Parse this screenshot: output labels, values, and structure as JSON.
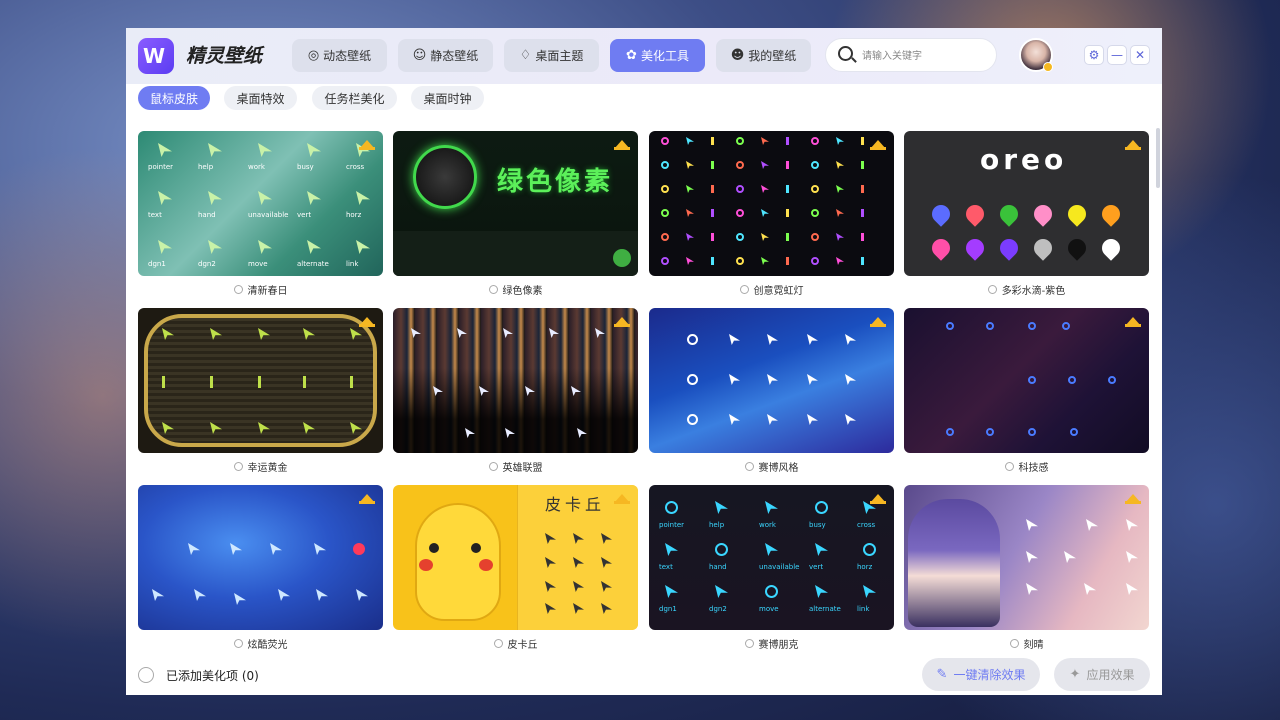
{
  "app": {
    "title": "精灵壁纸",
    "logo_letter": "W"
  },
  "nav": {
    "tabs": [
      {
        "label": "动态壁纸",
        "icon": "◎",
        "active": false
      },
      {
        "label": "静态壁纸",
        "icon": "☺",
        "active": false
      },
      {
        "label": "桌面主题",
        "icon": "♢",
        "active": false
      },
      {
        "label": "美化工具",
        "icon": "✿",
        "active": true
      },
      {
        "label": "我的壁纸",
        "icon": "☻",
        "active": false
      }
    ]
  },
  "search": {
    "placeholder": "请输入关键字",
    "value": ""
  },
  "window_controls": {
    "settings": "⚙",
    "minimize": "—",
    "close": "✕"
  },
  "subtabs": [
    {
      "label": "鼠标皮肤",
      "active": true
    },
    {
      "label": "桌面特效",
      "active": false
    },
    {
      "label": "任务栏美化",
      "active": false
    },
    {
      "label": "桌面时钟",
      "active": false
    }
  ],
  "items": [
    {
      "name": "清新春日",
      "premium": true
    },
    {
      "name": "绿色像素",
      "premium": true
    },
    {
      "name": "创意霓虹灯",
      "premium": true
    },
    {
      "name": "多彩水滴-紫色",
      "premium": true
    },
    {
      "name": "幸运黄金",
      "premium": true
    },
    {
      "name": "英雄联盟",
      "premium": true
    },
    {
      "name": "赛博风格",
      "premium": true
    },
    {
      "name": "科技感",
      "premium": true
    },
    {
      "name": "炫酷荧光",
      "premium": true
    },
    {
      "name": "皮卡丘",
      "premium": true
    },
    {
      "name": "赛博朋克",
      "premium": true
    },
    {
      "name": "刻晴",
      "premium": true
    }
  ],
  "thumb_text": {
    "spring_labels": [
      "pointer",
      "help",
      "work",
      "busy",
      "cross",
      "text",
      "hand",
      "unavailable",
      "vert",
      "horz",
      "dgn1",
      "dgn2",
      "move",
      "alternate",
      "link"
    ],
    "green_pixel": "绿色像素",
    "oreo": "oreo",
    "pikachu": "皮卡丘",
    "cyber_labels": [
      "pointer",
      "help",
      "work",
      "busy",
      "cross",
      "text",
      "hand",
      "unavailable",
      "vert",
      "horz",
      "dgn1",
      "dgn2",
      "move",
      "alternate",
      "link"
    ]
  },
  "footer": {
    "selected_text": "已添加美化项 (0)",
    "clear_button": "一键清除效果",
    "apply_button": "应用效果"
  },
  "colors": {
    "accent": "#6f7cf2",
    "premium": "#f6b722"
  }
}
